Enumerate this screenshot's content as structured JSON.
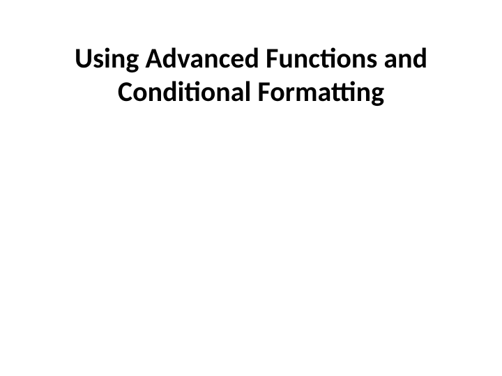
{
  "slide": {
    "title_line1": "Using Advanced Functions and",
    "title_line2": "Conditional Formatting"
  }
}
